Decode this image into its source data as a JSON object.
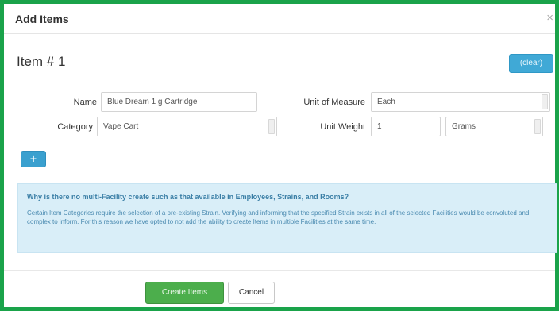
{
  "dialog": {
    "title": "Add Items",
    "close_glyph": "×",
    "close_icon": "close-icon"
  },
  "item": {
    "heading": "Item # 1",
    "clear_label": "(clear)",
    "add_label": "+",
    "add_icon": "plus-icon"
  },
  "form": {
    "name_label": "Name",
    "name_value": "Blue Dream 1 g Cartridge",
    "category_label": "Category",
    "category_value": "Vape Cart",
    "uom_label": "Unit of Measure",
    "uom_value": "Each",
    "weight_label": "Unit Weight",
    "weight_value": "1",
    "weight_unit_value": "Grams"
  },
  "info": {
    "heading": "Why is there no multi-Facility create such as that available in Employees, Strains, and Rooms?",
    "body": "Certain Item Categories require the selection of a pre-existing Strain. Verifying and informing that the specified Strain exists in all of the selected Facilities would be convoluted and complex to inform. For this reason we have opted to not add the ability to create Items in multiple Facilities at the same time."
  },
  "footer": {
    "create_label": "Create Items",
    "cancel_label": "Cancel"
  },
  "colors": {
    "frame_border": "#1aa34a",
    "clear_button": "#40a9d6",
    "add_button": "#3aa0cf",
    "create_button": "#4cae4c",
    "info_background": "#d9eef8"
  }
}
